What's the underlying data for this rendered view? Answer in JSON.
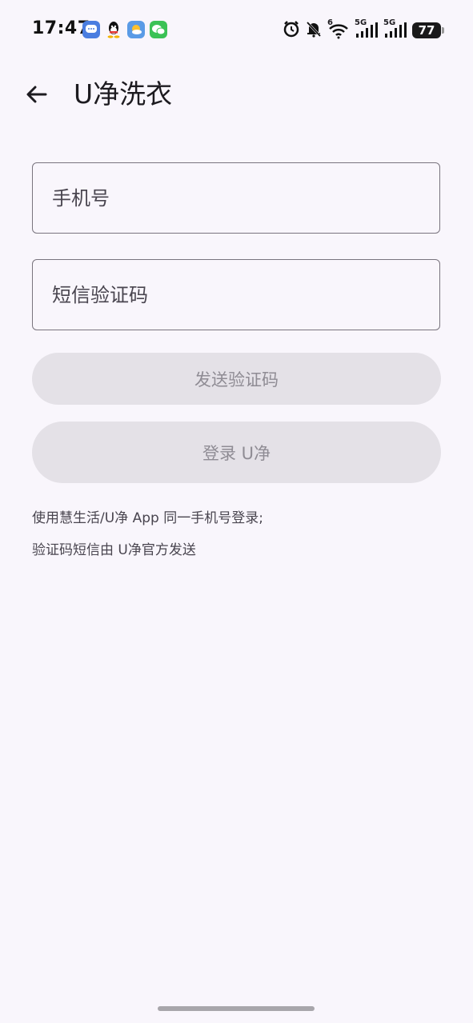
{
  "status_bar": {
    "time": "17:47",
    "notification_icons": [
      "messages-icon",
      "qq-icon",
      "weather-icon",
      "wechat-icon"
    ],
    "signal_1_label": "5G",
    "signal_2_label": "5G",
    "wifi_label": "6",
    "battery_level": "77"
  },
  "app_bar": {
    "title": "U净洗衣"
  },
  "form": {
    "phone_placeholder": "手机号",
    "code_placeholder": "短信验证码",
    "send_code_label": "发送验证码",
    "login_label": "登录 U净"
  },
  "notes": {
    "line1": "使用慧生活/U净 App 同一手机号登录;",
    "line2": "验证码短信由 U净官方发送"
  },
  "colors": {
    "background": "#f9f6fc",
    "button_disabled_bg": "#e4e1e7",
    "button_disabled_text": "#8f8c94",
    "field_border": "#79747e"
  }
}
